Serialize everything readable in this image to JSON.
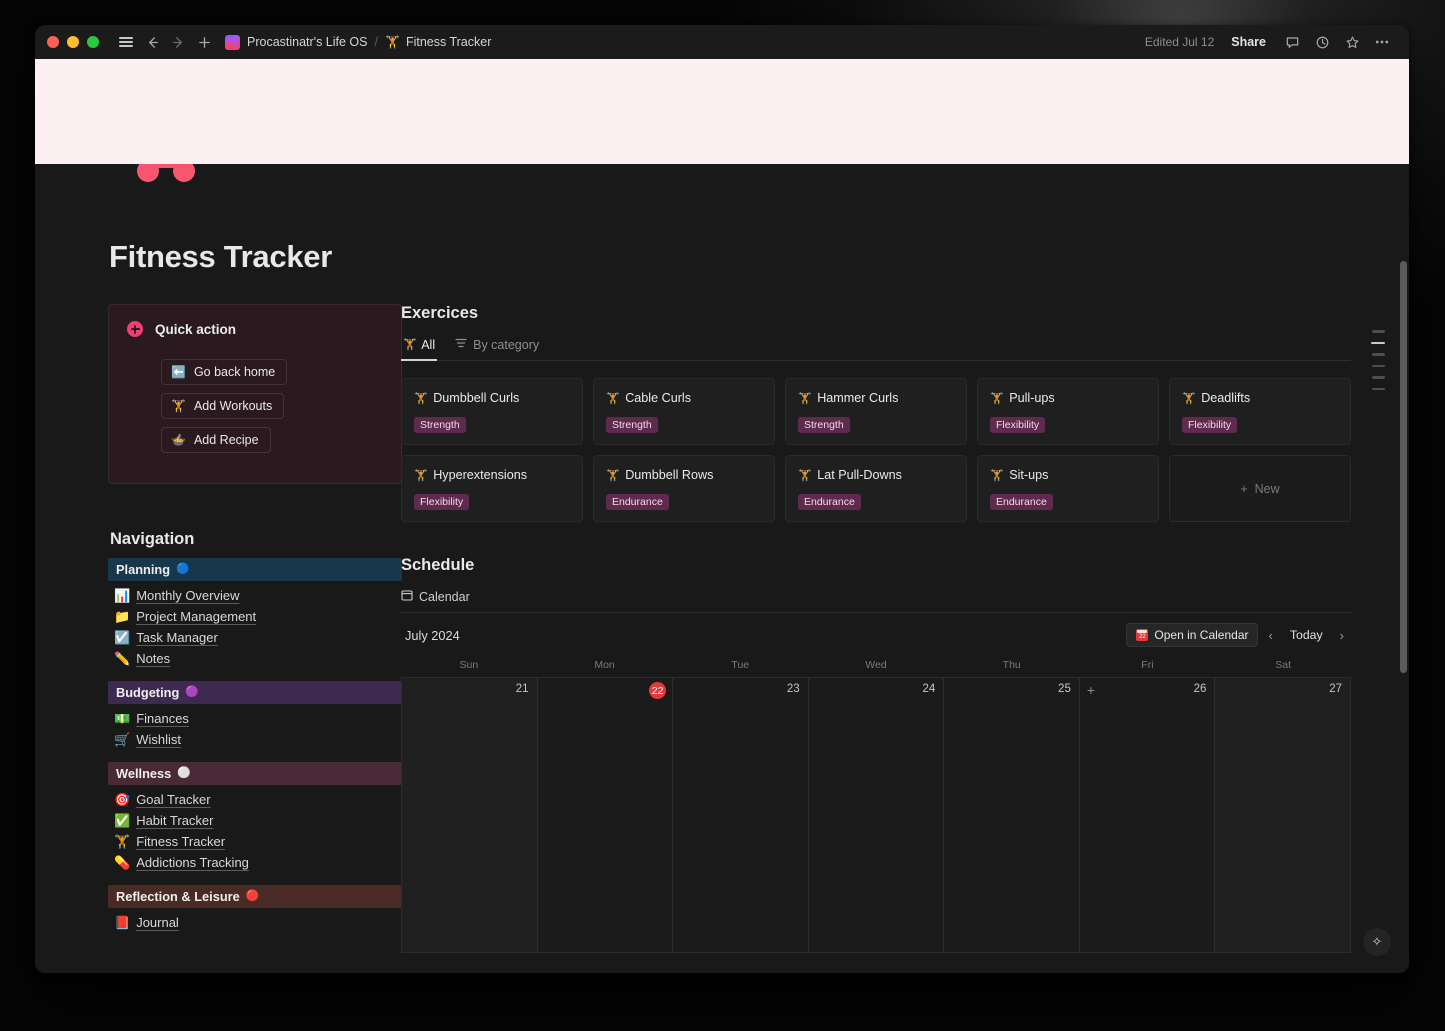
{
  "titlebar": {
    "breadcrumb_workspace": "Procastinatr's Life OS",
    "breadcrumb_separator": "/",
    "breadcrumb_page": "Fitness Tracker",
    "edited": "Edited Jul 12",
    "share_label": "Share",
    "icons": [
      "hamburger-icon",
      "back-arrow-icon",
      "forward-arrow-icon",
      "plus-icon",
      "comment-icon",
      "history-icon",
      "star-icon",
      "more-icon"
    ]
  },
  "page": {
    "title": "Fitness Tracker",
    "icon": "dumbbell-icon"
  },
  "quick_action": {
    "title": "Quick action",
    "buttons": [
      {
        "label": "Go back home",
        "icon": "⬅️"
      },
      {
        "label": "Add Workouts",
        "icon": "🏋"
      },
      {
        "label": "Add Recipe",
        "icon": "🍲"
      }
    ]
  },
  "navigation": {
    "title": "Navigation",
    "groups": [
      {
        "label": "Planning",
        "bullet": "🔵",
        "color": "#17374d",
        "links": [
          {
            "label": "Monthly Overview",
            "emoji": "📊"
          },
          {
            "label": "Project Management",
            "emoji": "📁"
          },
          {
            "label": "Task Manager",
            "emoji": "☑️"
          },
          {
            "label": "Notes",
            "emoji": "✏️"
          }
        ]
      },
      {
        "label": "Budgeting",
        "bullet": "🟣",
        "color": "#3e2a50",
        "links": [
          {
            "label": "Finances",
            "emoji": "💵"
          },
          {
            "label": "Wishlist",
            "emoji": "🛒"
          }
        ]
      },
      {
        "label": "Wellness",
        "bullet": "⚪",
        "color": "#4a2a36",
        "links": [
          {
            "label": "Goal Tracker",
            "emoji": "🎯"
          },
          {
            "label": "Habit Tracker",
            "emoji": "✅"
          },
          {
            "label": "Fitness Tracker",
            "emoji": "🏋"
          },
          {
            "label": "Addictions Tracking",
            "emoji": "💊"
          }
        ]
      },
      {
        "label": "Reflection & Leisure",
        "bullet": "🔴",
        "color": "#4a2a24",
        "links": [
          {
            "label": "Journal",
            "emoji": "📕"
          }
        ]
      }
    ]
  },
  "exercises": {
    "section_title": "Exercices",
    "tabs": [
      {
        "label": "All",
        "icon": "dumbbell-icon",
        "active": true
      },
      {
        "label": "By category",
        "icon": "group-icon",
        "active": false
      }
    ],
    "new_label": "New",
    "items": [
      {
        "name": "Dumbbell Curls",
        "tag": "Strength"
      },
      {
        "name": "Cable Curls",
        "tag": "Strength"
      },
      {
        "name": "Hammer Curls",
        "tag": "Strength"
      },
      {
        "name": "Pull-ups",
        "tag": "Flexibility"
      },
      {
        "name": "Deadlifts",
        "tag": "Flexibility"
      },
      {
        "name": "Hyperextensions",
        "tag": "Flexibility"
      },
      {
        "name": "Dumbbell Rows",
        "tag": "Endurance"
      },
      {
        "name": "Lat Pull-Downs",
        "tag": "Endurance"
      },
      {
        "name": "Sit-ups",
        "tag": "Endurance"
      }
    ]
  },
  "schedule": {
    "section_title": "Schedule",
    "view_tab": "Calendar",
    "month": "July 2024",
    "open_in_calendar": "Open in Calendar",
    "today_label": "Today",
    "prev_label": "‹",
    "next_label": "›",
    "weekdays": [
      "Sun",
      "Mon",
      "Tue",
      "Wed",
      "Thu",
      "Fri",
      "Sat"
    ],
    "days": [
      {
        "num": "21",
        "today": false,
        "weekend": true,
        "plus": false
      },
      {
        "num": "22",
        "today": true,
        "weekend": false,
        "plus": false
      },
      {
        "num": "23",
        "today": false,
        "weekend": false,
        "plus": false
      },
      {
        "num": "24",
        "today": false,
        "weekend": false,
        "plus": false
      },
      {
        "num": "25",
        "today": false,
        "weekend": false,
        "plus": false
      },
      {
        "num": "26",
        "today": false,
        "weekend": false,
        "plus": true
      },
      {
        "num": "27",
        "today": false,
        "weekend": true,
        "plus": false
      }
    ]
  },
  "floating": {
    "toc_items": 6,
    "toc_active_index": 1,
    "ai_icon": "✧"
  },
  "colors": {
    "accent_pink": "#f2516e",
    "today_red": "#e03b3b",
    "tag_bg": "#5f2a4d",
    "banner": "#fdf0f3",
    "window_bg": "#191919"
  }
}
